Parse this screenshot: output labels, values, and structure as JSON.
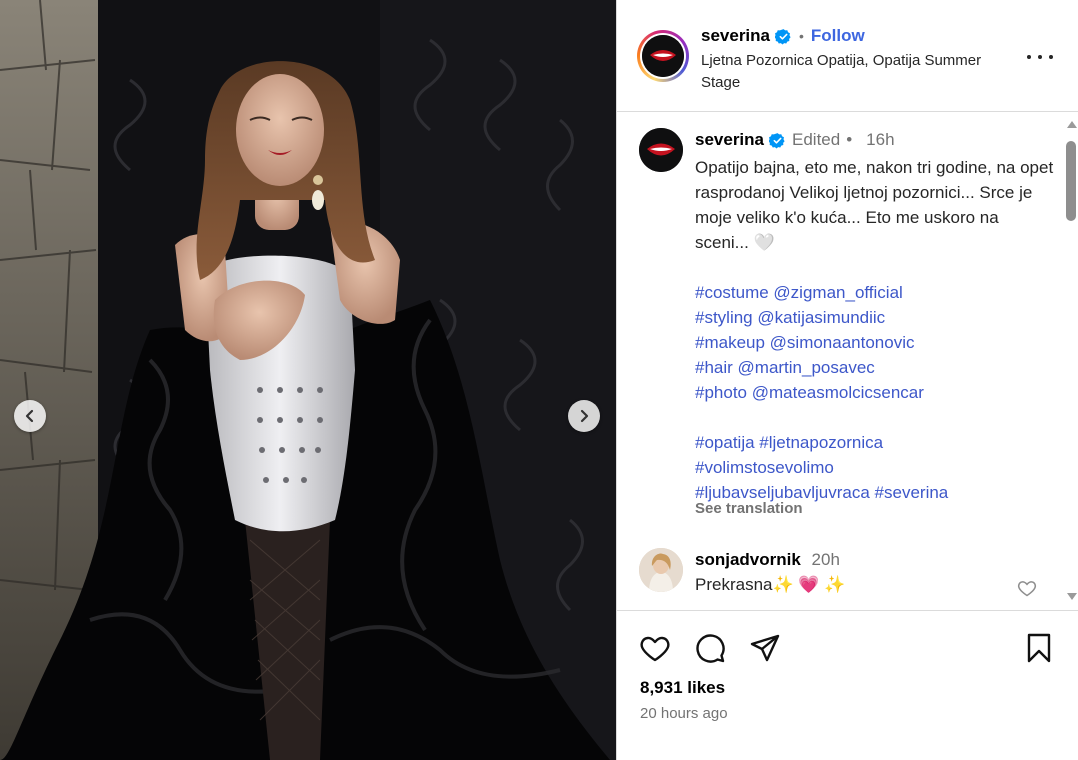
{
  "post": {
    "username": "severina",
    "follow_label": "Follow",
    "separator": "•",
    "location": "Ljetna Pozornica Opatija, Opatija Summer Stage"
  },
  "caption": {
    "username": "severina",
    "edited_label": "Edited",
    "separator": "•",
    "time": "16h",
    "text": "Opatijo bajna, eto me, nakon tri godine, na opet rasprodanoj Velikoj ljetnoj pozornici... Srce je moje veliko k'o kuća... Eto me uskoro na sceni... 🤍",
    "tags_block1": [
      "#costume @zigman_official",
      "#styling @katijasimundiic",
      "#makeup @simonaantonovic",
      "#hair @martin_posavec",
      "#photo @mateasmolcicsencar"
    ],
    "tags_block2": [
      "#opatija #ljetnapozornica",
      "#volimstosevolimo",
      "#ljubavseljubavljuvraca #severina"
    ],
    "see_translation": "See translation"
  },
  "comment": {
    "username": "sonjadvornik",
    "time": "20h",
    "text": "Prekrasna✨ 💗 ✨"
  },
  "stats": {
    "likes": "8,931 likes",
    "posted": "20 hours ago"
  },
  "icons": [
    "chevron-left-icon",
    "chevron-right-icon",
    "verified-badge-icon",
    "more-options-icon",
    "heart-icon",
    "comment-icon",
    "share-icon",
    "bookmark-icon"
  ],
  "colors": {
    "link": "#3d57c9",
    "verified": "#0095f6",
    "muted": "#737373"
  }
}
